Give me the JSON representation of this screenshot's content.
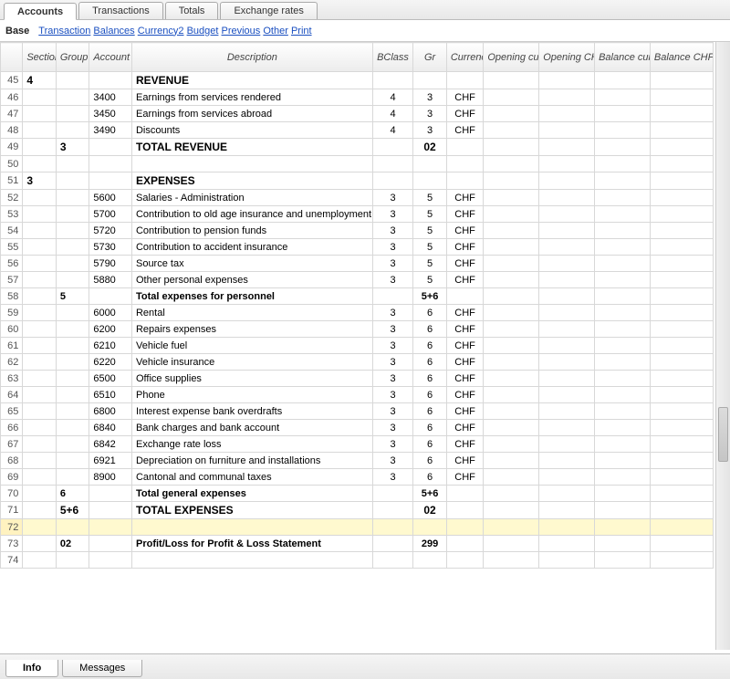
{
  "tabs_top": [
    "Accounts",
    "Transactions",
    "Totals",
    "Exchange rates"
  ],
  "tabs_top_active": 0,
  "subnav": {
    "base": "Base",
    "links": [
      "Transaction",
      "Balances",
      "Currency2",
      "Budget",
      "Previous",
      "Other",
      "Print"
    ]
  },
  "columns": [
    "",
    "Section",
    "Group",
    "Account",
    "Description",
    "BClass",
    "Gr",
    "Currency",
    "Opening currency",
    "Opening CHF",
    "Balance currency",
    "Balance CHF"
  ],
  "rows": [
    {
      "n": 45,
      "section": "4",
      "group": "",
      "account": "",
      "desc": "REVENUE",
      "bclass": "",
      "gr": "",
      "curr": "",
      "style": "strong"
    },
    {
      "n": 46,
      "section": "",
      "group": "",
      "account": "3400",
      "desc": "Earnings from services rendered",
      "bclass": "4",
      "gr": "3",
      "curr": "CHF"
    },
    {
      "n": 47,
      "section": "",
      "group": "",
      "account": "3450",
      "desc": "Earnings from services abroad",
      "bclass": "4",
      "gr": "3",
      "curr": "CHF"
    },
    {
      "n": 48,
      "section": "",
      "group": "",
      "account": "3490",
      "desc": "Discounts",
      "bclass": "4",
      "gr": "3",
      "curr": "CHF"
    },
    {
      "n": 49,
      "section": "",
      "group": "3",
      "account": "",
      "desc": "TOTAL REVENUE",
      "bclass": "",
      "gr": "02",
      "curr": "",
      "style": "strong"
    },
    {
      "n": 50,
      "section": "",
      "group": "",
      "account": "",
      "desc": "",
      "bclass": "",
      "gr": "",
      "curr": ""
    },
    {
      "n": 51,
      "section": "3",
      "group": "",
      "account": "",
      "desc": "EXPENSES",
      "bclass": "",
      "gr": "",
      "curr": "",
      "style": "strong"
    },
    {
      "n": 52,
      "section": "",
      "group": "",
      "account": "5600",
      "desc": "Salaries - Administration",
      "bclass": "3",
      "gr": "5",
      "curr": "CHF"
    },
    {
      "n": 53,
      "section": "",
      "group": "",
      "account": "5700",
      "desc": "Contribution to old age insurance and unemployment",
      "bclass": "3",
      "gr": "5",
      "curr": "CHF"
    },
    {
      "n": 54,
      "section": "",
      "group": "",
      "account": "5720",
      "desc": "Contribution to pension funds",
      "bclass": "3",
      "gr": "5",
      "curr": "CHF"
    },
    {
      "n": 55,
      "section": "",
      "group": "",
      "account": "5730",
      "desc": "Contribution to accident insurance",
      "bclass": "3",
      "gr": "5",
      "curr": "CHF"
    },
    {
      "n": 56,
      "section": "",
      "group": "",
      "account": "5790",
      "desc": "Source tax",
      "bclass": "3",
      "gr": "5",
      "curr": "CHF"
    },
    {
      "n": 57,
      "section": "",
      "group": "",
      "account": "5880",
      "desc": "Other personal expenses",
      "bclass": "3",
      "gr": "5",
      "curr": "CHF"
    },
    {
      "n": 58,
      "section": "",
      "group": "5",
      "account": "",
      "desc": "Total expenses for personnel",
      "bclass": "",
      "gr": "5+6",
      "curr": "",
      "style": "semistrong"
    },
    {
      "n": 59,
      "section": "",
      "group": "",
      "account": "6000",
      "desc": "Rental",
      "bclass": "3",
      "gr": "6",
      "curr": "CHF"
    },
    {
      "n": 60,
      "section": "",
      "group": "",
      "account": "6200",
      "desc": "Repairs expenses",
      "bclass": "3",
      "gr": "6",
      "curr": "CHF"
    },
    {
      "n": 61,
      "section": "",
      "group": "",
      "account": "6210",
      "desc": "Vehicle fuel",
      "bclass": "3",
      "gr": "6",
      "curr": "CHF"
    },
    {
      "n": 62,
      "section": "",
      "group": "",
      "account": "6220",
      "desc": "Vehicle insurance",
      "bclass": "3",
      "gr": "6",
      "curr": "CHF"
    },
    {
      "n": 63,
      "section": "",
      "group": "",
      "account": "6500",
      "desc": "Office supplies",
      "bclass": "3",
      "gr": "6",
      "curr": "CHF"
    },
    {
      "n": 64,
      "section": "",
      "group": "",
      "account": "6510",
      "desc": "Phone",
      "bclass": "3",
      "gr": "6",
      "curr": "CHF"
    },
    {
      "n": 65,
      "section": "",
      "group": "",
      "account": "6800",
      "desc": "Interest expense bank overdrafts",
      "bclass": "3",
      "gr": "6",
      "curr": "CHF"
    },
    {
      "n": 66,
      "section": "",
      "group": "",
      "account": "6840",
      "desc": "Bank charges and bank account",
      "bclass": "3",
      "gr": "6",
      "curr": "CHF"
    },
    {
      "n": 67,
      "section": "",
      "group": "",
      "account": "6842",
      "desc": "Exchange rate loss",
      "bclass": "3",
      "gr": "6",
      "curr": "CHF"
    },
    {
      "n": 68,
      "section": "",
      "group": "",
      "account": "6921",
      "desc": "Depreciation on furniture and installations",
      "bclass": "3",
      "gr": "6",
      "curr": "CHF"
    },
    {
      "n": 69,
      "section": "",
      "group": "",
      "account": "8900",
      "desc": "Cantonal and communal taxes",
      "bclass": "3",
      "gr": "6",
      "curr": "CHF"
    },
    {
      "n": 70,
      "section": "",
      "group": "6",
      "account": "",
      "desc": "Total general expenses",
      "bclass": "",
      "gr": "5+6",
      "curr": "",
      "style": "semistrong"
    },
    {
      "n": 71,
      "section": "",
      "group": "5+6",
      "account": "",
      "desc": "TOTAL EXPENSES",
      "bclass": "",
      "gr": "02",
      "curr": "",
      "style": "strong"
    },
    {
      "n": 72,
      "section": "",
      "group": "",
      "account": "",
      "desc": "",
      "bclass": "",
      "gr": "",
      "curr": "",
      "selected": true
    },
    {
      "n": 73,
      "section": "",
      "group": "02",
      "account": "",
      "desc": "Profit/Loss for Profit & Loss Statement",
      "bclass": "",
      "gr": "299",
      "curr": "",
      "style": "semistrong"
    },
    {
      "n": 74,
      "section": "",
      "group": "",
      "account": "",
      "desc": "",
      "bclass": "",
      "gr": "",
      "curr": ""
    }
  ],
  "tabs_bottom": [
    "Info",
    "Messages"
  ],
  "tabs_bottom_active": 0
}
